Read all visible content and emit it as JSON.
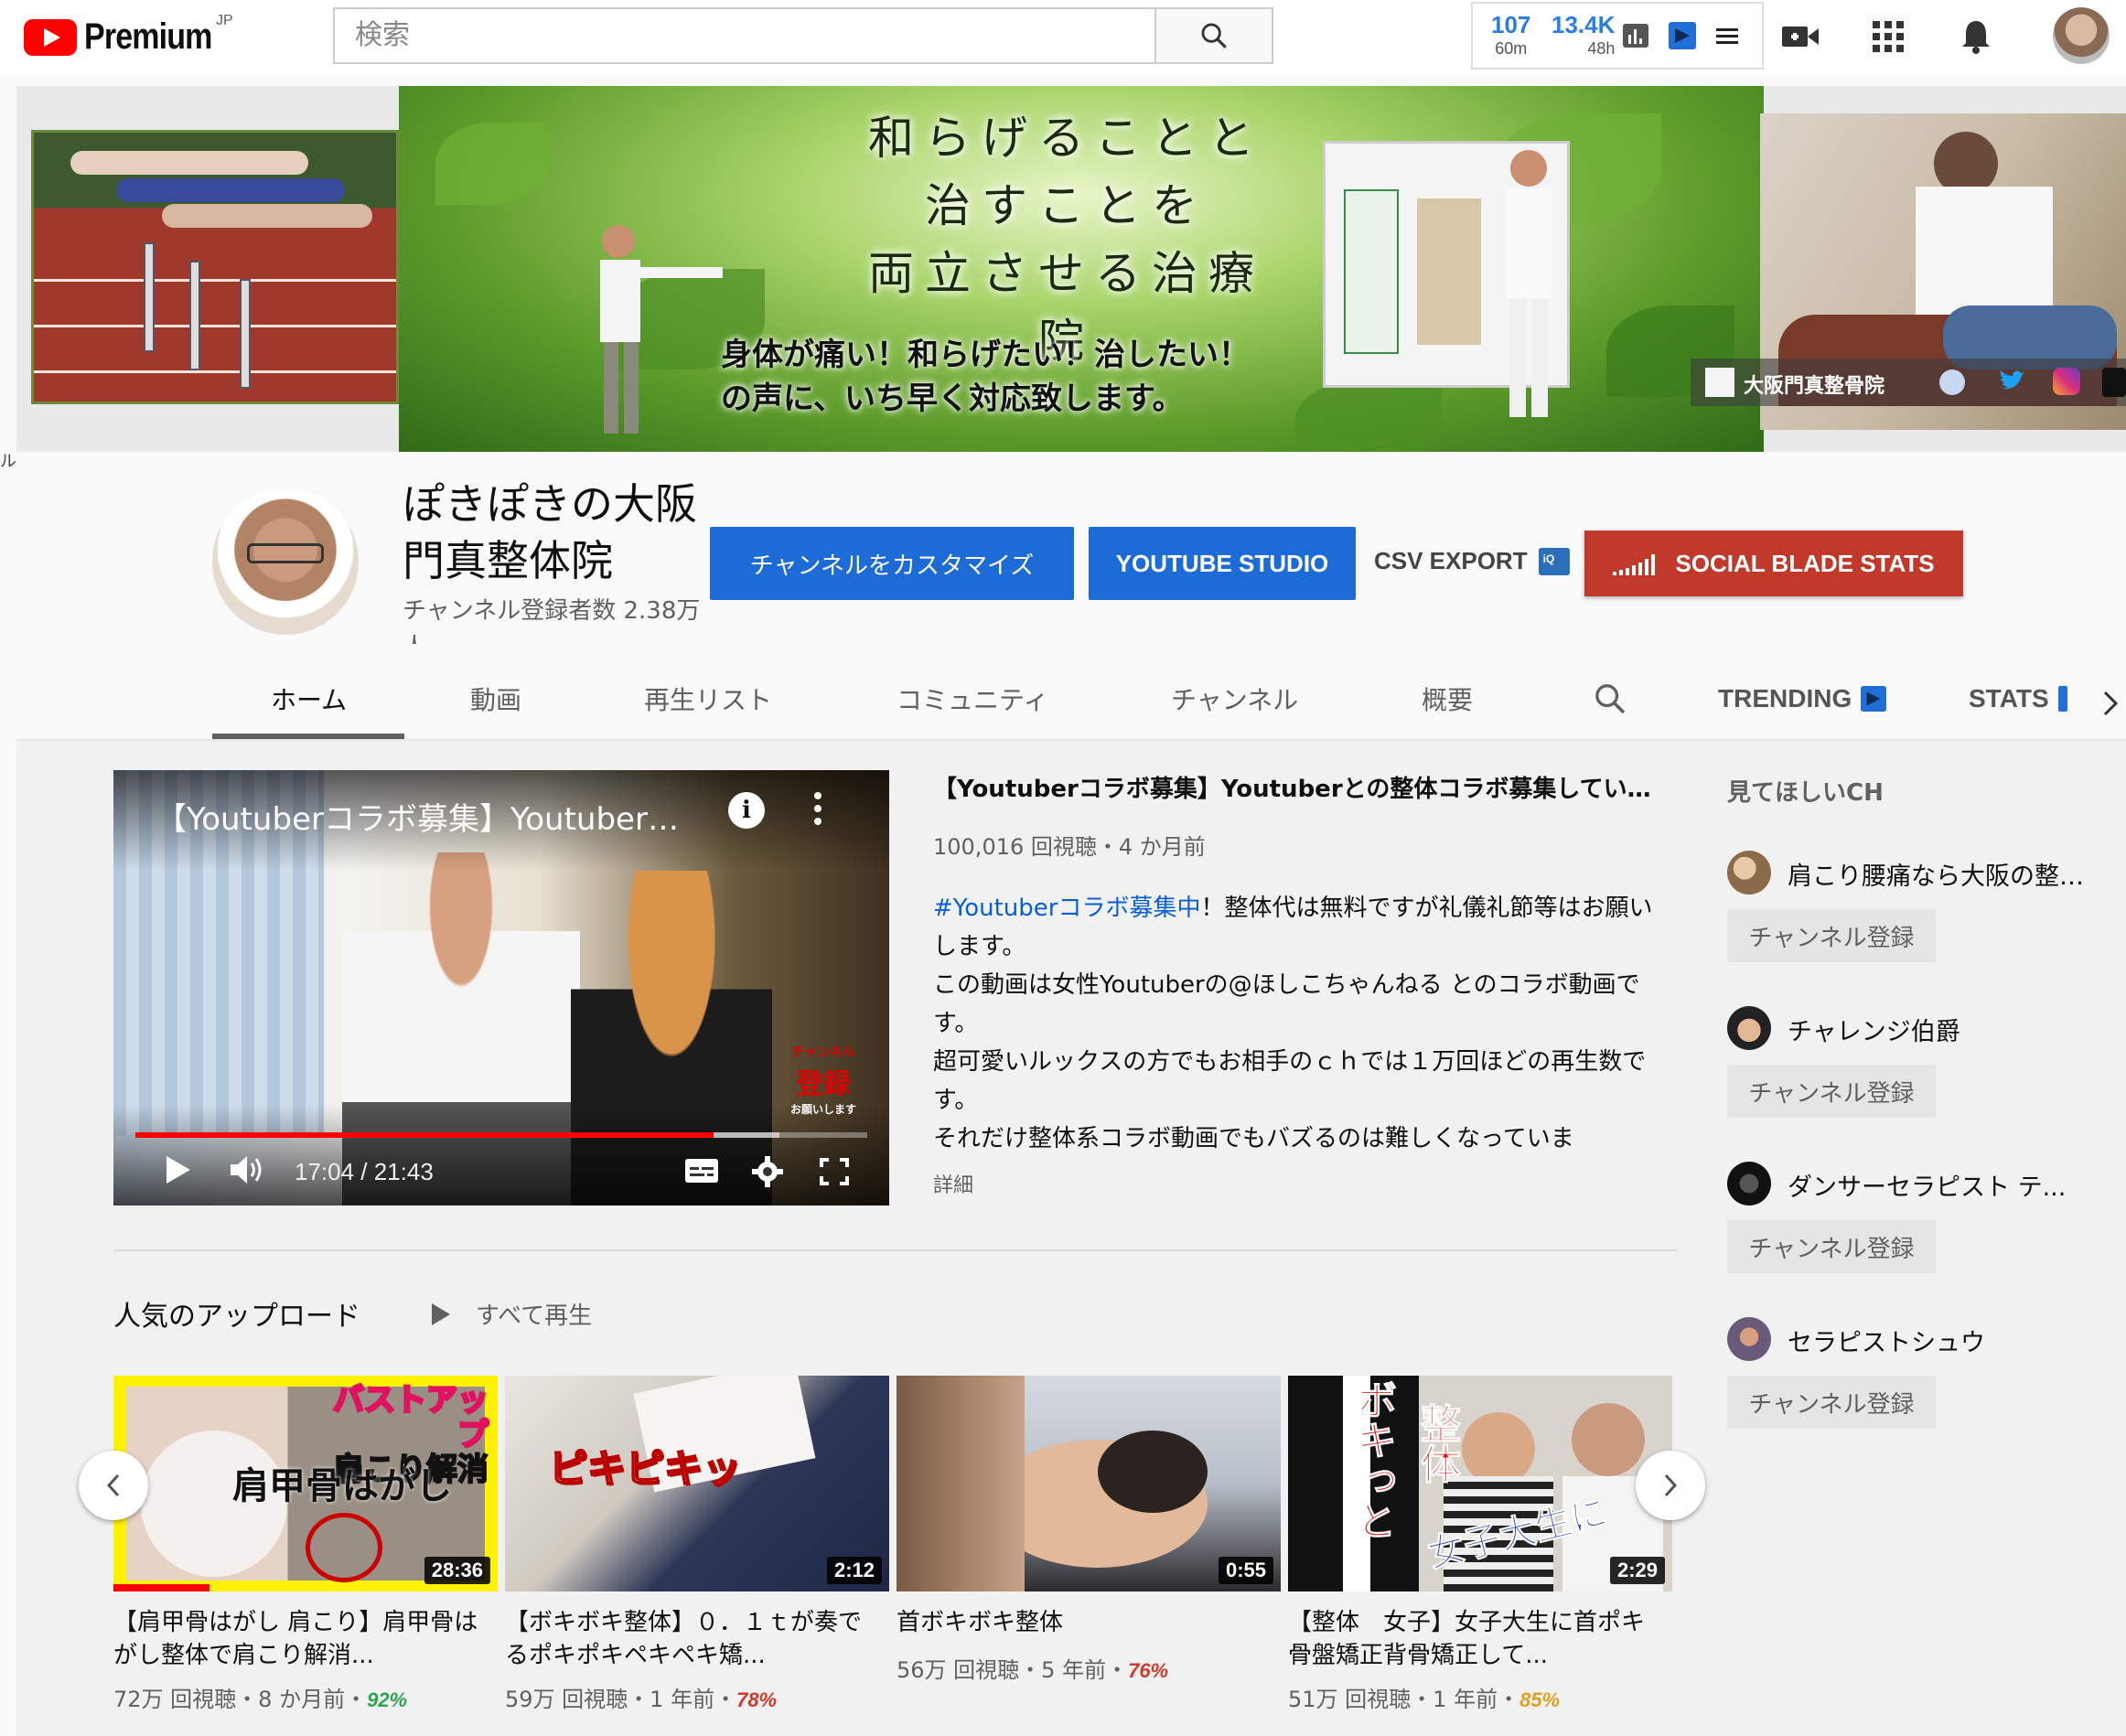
{
  "header": {
    "logo_text": "Premium",
    "country": "JP",
    "search_placeholder": "検索",
    "stats": [
      {
        "value": "107",
        "label": "60m"
      },
      {
        "value": "13.4K",
        "label": "48h"
      }
    ]
  },
  "banner": {
    "title_lines": [
      "和らげることと",
      "治すことを",
      "両立させる治療院"
    ],
    "sub_lines": [
      "身体が痛い！和らげたい！治したい！",
      "の声に、いち早く対応致します。"
    ],
    "social_name": "大阪門真整骨院"
  },
  "channel": {
    "name": "ぽきぽきの大阪門真整体院",
    "subscribers": "チャンネル登録者数 2.38万人",
    "customize_label": "チャンネルをカスタマイズ",
    "studio_label": "YOUTUBE STUDIO",
    "csv_label": "CSV EXPORT",
    "socialblade_label": "SOCIAL BLADE STATS"
  },
  "tabs": [
    "ホーム",
    "動画",
    "再生リスト",
    "コミュニティ",
    "チャンネル",
    "概要",
    "TRENDING",
    "STATS"
  ],
  "featured": {
    "player_title": "【Youtuberコラボ募集】Youtuberとの整体コラボ募集していま...",
    "player_time": "17:04 / 21:43",
    "progress": 0.79,
    "sub_badge_small": "チャンネル",
    "sub_badge_big": "登録",
    "sub_badge_note": "お願いします",
    "title": "【Youtuberコラボ募集】Youtuberとの整体コラボ募集していま...",
    "meta": "100,016 回視聴・4 か月前",
    "desc_tag": "#Youtuberコラボ募集中",
    "desc_lines": [
      "！整体代は無料ですが礼儀礼節等はお願いします。",
      "この動画は女性Youtuberの@ほしこちゃんねる とのコラボ動画です。",
      "超可愛いルックスの方でもお相手のｃｈでは１万回ほどの再生数です。",
      "それだけ整体系コラボ動画でもバズるのは難しくなっていま"
    ],
    "more": "詳細"
  },
  "popular": {
    "title": "人気のアップロード",
    "play_all": "すべて再生",
    "videos": [
      {
        "thumb_text1": "バストアップ",
        "thumb_text2": "肩こり解消",
        "thumb_text3": "肩甲骨はがし",
        "duration": "28:36",
        "title": "【肩甲骨はがし 肩こり】肩甲骨はがし整体で肩こり解消...",
        "views": "72万 回視聴・8 か月前・",
        "score": "92%",
        "score_color": "#2ea44f",
        "watched": 0.25
      },
      {
        "thumb_text1": "ピキピキッ",
        "duration": "2:12",
        "title": "【ボキボキ整体】０．１ｔが奏でるポキポキペキペキ矯...",
        "views": "59万 回視聴・1 年前・",
        "score": "78%",
        "score_color": "#d03a2a"
      },
      {
        "duration": "0:55",
        "title": "首ボキボキ整体",
        "views": "56万 回視聴・5 年前・",
        "score": "76%",
        "score_color": "#d03a2a"
      },
      {
        "thumb_text1": "ボキっと",
        "thumb_text2": "整体",
        "thumb_text3": "女子大生に",
        "duration": "2:29",
        "title": "【整体　女子】女子大生に首ポキ骨盤矯正背骨矯正して...",
        "views": "51万 回視聴・1 年前・",
        "score": "85%",
        "score_color": "#e0a020"
      }
    ]
  },
  "recommended": {
    "heading": "見てほしいCH",
    "channels": [
      {
        "name": "肩こり腰痛なら大阪の整体院",
        "button": "チャンネル登録"
      },
      {
        "name": "チャレンジ伯爵",
        "button": "チャンネル登録"
      },
      {
        "name": "ダンサーセラピスト テ...",
        "button": "チャンネル登録"
      },
      {
        "name": "セラピストシュウ",
        "button": "チャンネル登録"
      }
    ]
  },
  "edge_text": "ル"
}
